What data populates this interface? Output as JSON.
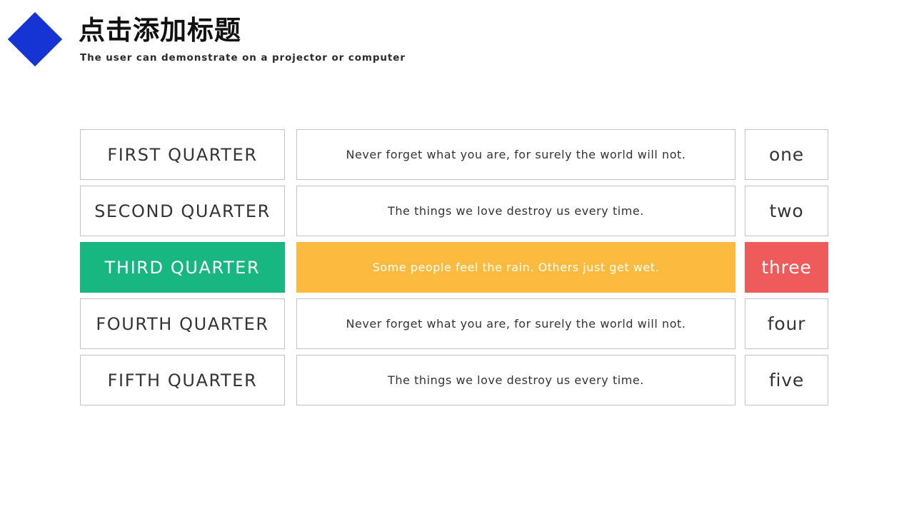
{
  "header": {
    "title": "点击添加标题",
    "subtitle": "The user can demonstrate on a projector or computer",
    "diamond_color": "#1634d4"
  },
  "colors": {
    "highlight_label_bg": "#18b681",
    "highlight_desc_bg": "#fcba3e",
    "highlight_index_bg": "#ef5a5a",
    "cell_border": "#c3c3c3",
    "cell_bg": "#ffffff",
    "text": "#343434",
    "highlight_text": "#ffffff"
  },
  "rows": [
    {
      "label": "FIRST QUARTER",
      "description": "Never forget what you are, for surely the world will not.",
      "index": "one",
      "highlighted": false
    },
    {
      "label": "SECOND QUARTER",
      "description": "The things we love destroy us every time.",
      "index": "two",
      "highlighted": false
    },
    {
      "label": "THIRD QUARTER",
      "description": "Some people feel the rain. Others just get wet.",
      "index": "three",
      "highlighted": true
    },
    {
      "label": "FOURTH QUARTER",
      "description": "Never forget what you are, for surely the world will not.",
      "index": "four",
      "highlighted": false
    },
    {
      "label": "FIFTH QUARTER",
      "description": "The things we love destroy us every time.",
      "index": "five",
      "highlighted": false
    }
  ]
}
